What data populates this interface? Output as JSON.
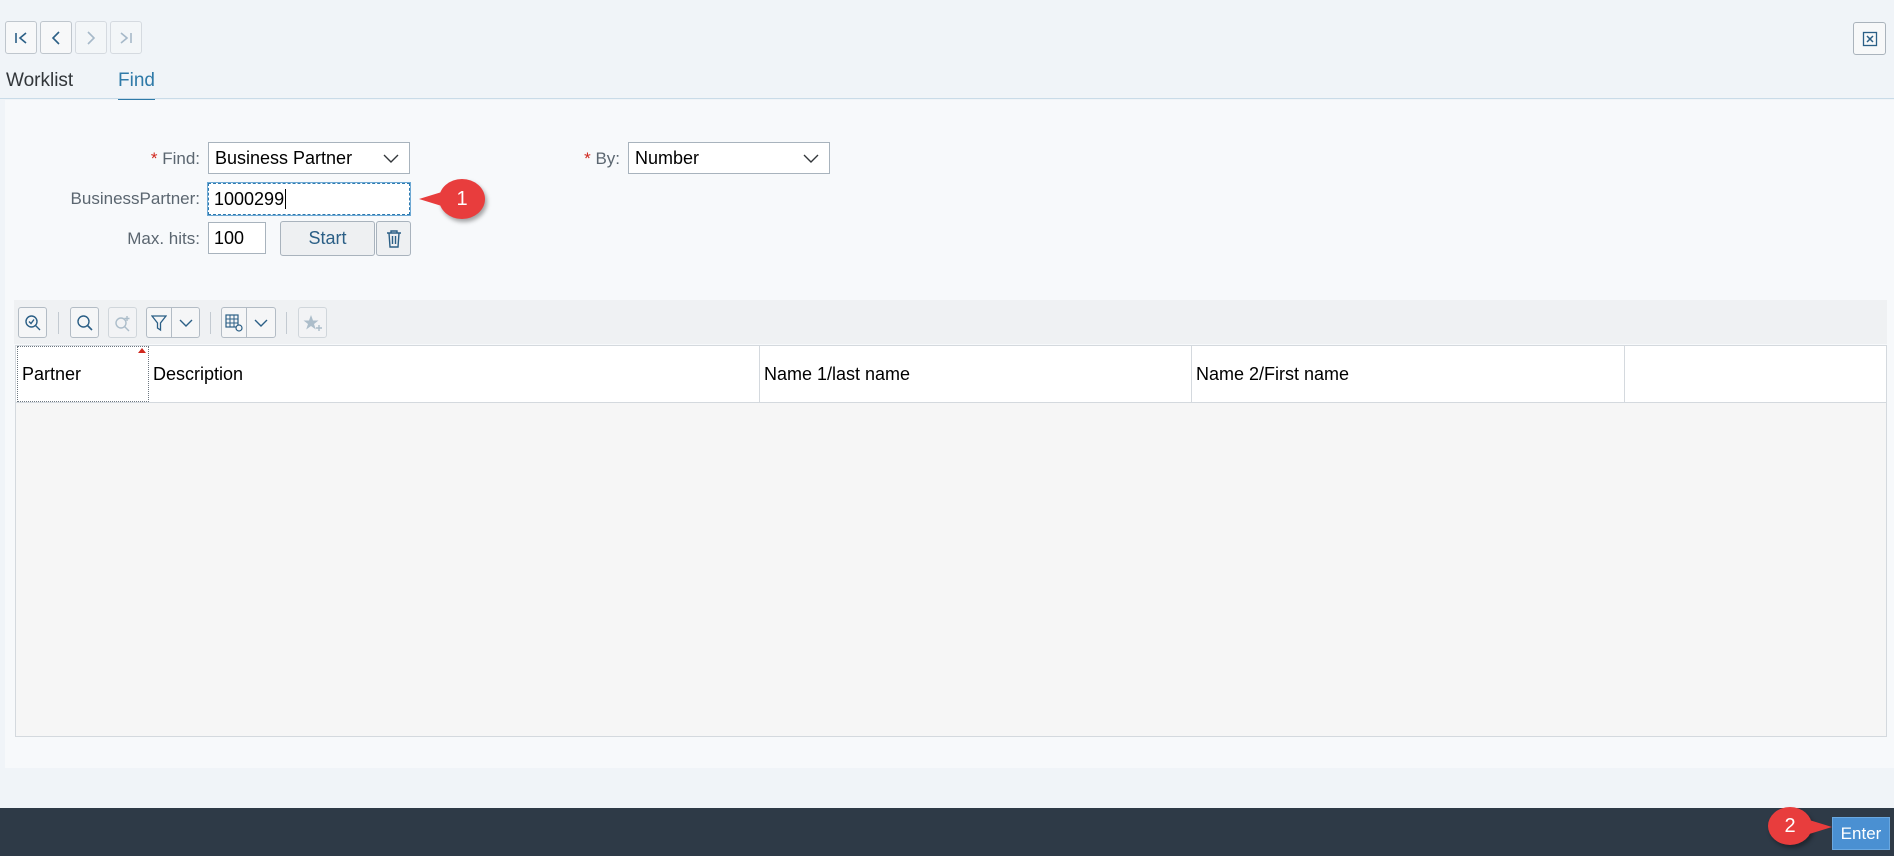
{
  "nav": {
    "first_icon": "first-page-icon",
    "prev_icon": "previous-page-icon",
    "next_icon": "next-page-icon",
    "last_icon": "last-page-icon",
    "close_icon": "close-window-icon"
  },
  "tabs": [
    {
      "label": "Worklist",
      "active": false
    },
    {
      "label": "Find",
      "active": true
    }
  ],
  "form": {
    "required_marker": "*",
    "find_label": "Find:",
    "find_value": "Business Partner",
    "by_label": "By:",
    "by_value": "Number",
    "partner_label": "BusinessPartner:",
    "partner_value": "1000299",
    "maxhits_label": "Max. hits:",
    "maxhits_value": "100",
    "start_label": "Start",
    "clear_icon": "trash-icon"
  },
  "toolbar": {
    "icons": [
      "zoom-details-icon",
      "search-icon",
      "search-next-icon",
      "filter-icon",
      "dropdown-icon",
      "column-settings-icon",
      "dropdown-icon",
      "favorite-add-icon"
    ]
  },
  "table": {
    "columns": [
      "Partner",
      "Description",
      "Name 1/last name",
      "Name 2/First name",
      ""
    ],
    "rows": []
  },
  "annotations": {
    "step1": "1",
    "step2": "2"
  },
  "footer": {
    "enter_label": "Enter"
  },
  "colors": {
    "accent": "#2f7aa8",
    "required": "#d0271d",
    "callout": "#e83d3d",
    "footer_bg": "#2e3a47",
    "enter_bg": "#4a90d2"
  }
}
